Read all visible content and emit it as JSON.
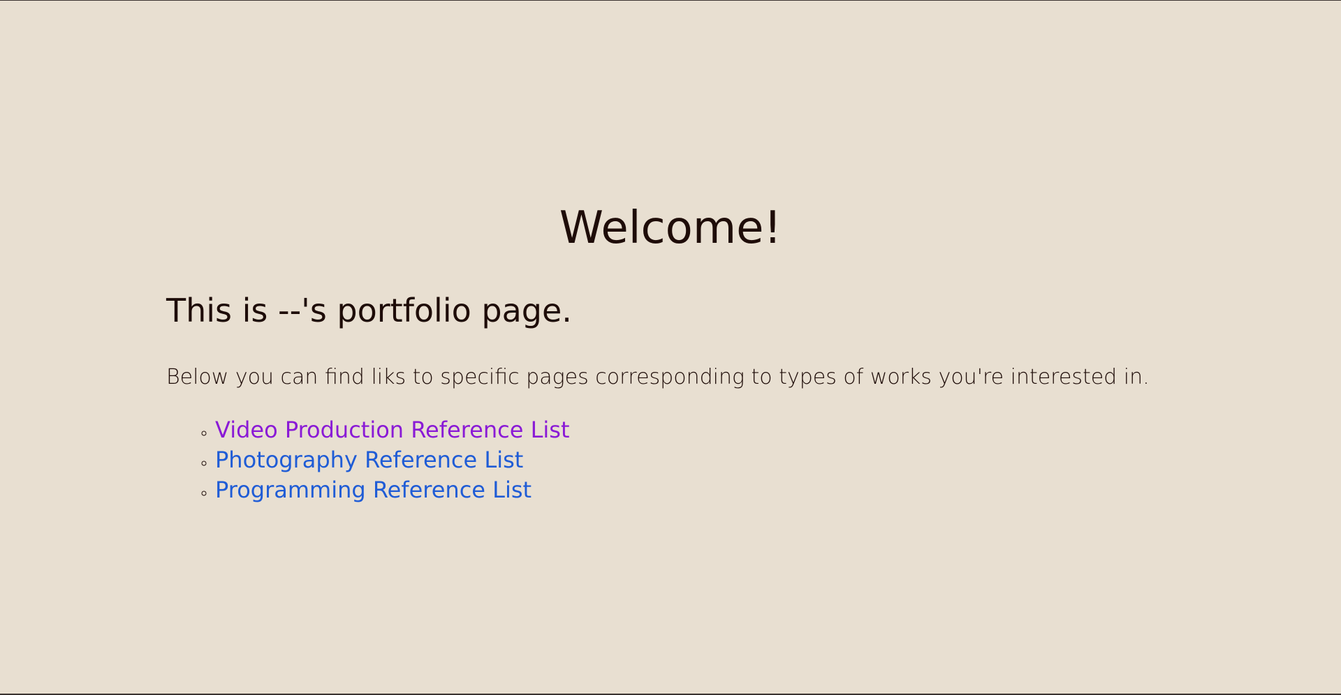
{
  "page": {
    "heading": "Welcome!",
    "subheading": "This is --'s portfolio page.",
    "intro": "Below you can find liks to specific pages corresponding to types of works you're interested in."
  },
  "links": [
    {
      "label": "Video Production Reference List",
      "state": "visited",
      "color": "#8a1ad6"
    },
    {
      "label": "Photography Reference List",
      "state": "unvisited",
      "color": "#1f5cd6"
    },
    {
      "label": "Programming Reference List",
      "state": "unvisited",
      "color": "#1f5cd6"
    }
  ],
  "colors": {
    "background": "#e8dfd1",
    "text": "#1e0c08"
  }
}
